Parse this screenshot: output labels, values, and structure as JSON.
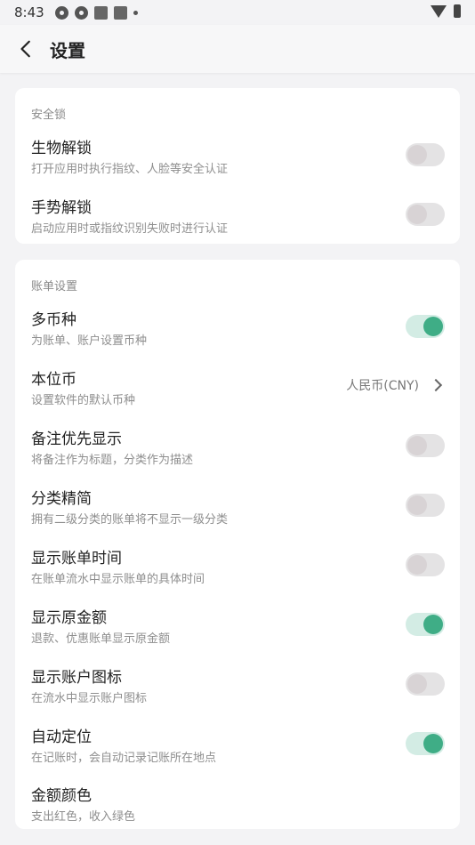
{
  "status": {
    "time": "8:43"
  },
  "header": {
    "title": "设置"
  },
  "security": {
    "title": "安全锁",
    "items": [
      {
        "label": "生物解锁",
        "desc": "打开应用时执行指纹、人脸等安全认证",
        "on": false
      },
      {
        "label": "手势解锁",
        "desc": "启动应用时或指纹识别失败时进行认证",
        "on": false
      }
    ]
  },
  "bill": {
    "title": "账单设置",
    "items": [
      {
        "label": "多币种",
        "desc": "为账单、账户设置币种",
        "on": true
      },
      {
        "label": "本位币",
        "desc": "设置软件的默认币种",
        "value": "人民币(CNY)"
      },
      {
        "label": "备注优先显示",
        "desc": "将备注作为标题，分类作为描述",
        "on": false
      },
      {
        "label": "分类精简",
        "desc": "拥有二级分类的账单将不显示一级分类",
        "on": false
      },
      {
        "label": "显示账单时间",
        "desc": "在账单流水中显示账单的具体时间",
        "on": false
      },
      {
        "label": "显示原金额",
        "desc": "退款、优惠账单显示原金额",
        "on": true
      },
      {
        "label": "显示账户图标",
        "desc": "在流水中显示账户图标",
        "on": false
      },
      {
        "label": "自动定位",
        "desc": "在记账时，会自动记录记账所在地点",
        "on": true
      },
      {
        "label": "金额颜色",
        "desc": "支出红色，收入绿色"
      }
    ]
  },
  "colors": {
    "accent": "#3fad86",
    "accent_track": "#d3ece4",
    "off_track": "#e4e3e4",
    "off_knob": "#d8d3d5"
  }
}
